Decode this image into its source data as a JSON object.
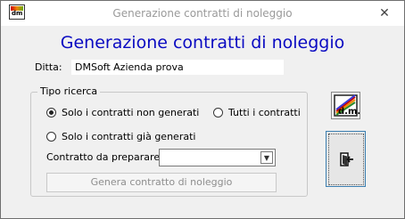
{
  "window": {
    "title": "Generazione contratti di noleggio",
    "close_glyph": "✕",
    "icon": "dm-app-icon"
  },
  "form": {
    "heading": "Generazione contratti di noleggio",
    "ditta_label": "Ditta:",
    "ditta_value": "DMSoft Azienda prova"
  },
  "tipo_ricerca": {
    "title": "Tipo ricerca",
    "options": [
      {
        "label": "Solo i contratti non generati",
        "selected": true
      },
      {
        "label": "Tutti i contratti",
        "selected": false
      },
      {
        "label": "Solo i contratti già generati",
        "selected": false
      }
    ],
    "contratto_label": "Contratto da preparare :",
    "contratto_value": ""
  },
  "buttons": {
    "generate_label": "Genera contratto di noleggio",
    "dm_icon": "dm-logo-icon",
    "exit_icon": "exit-door-icon"
  },
  "colors": {
    "heading": "#0a0ac2",
    "window_bg": "#f0f0f0",
    "exit_border": "#3c7fb1"
  }
}
